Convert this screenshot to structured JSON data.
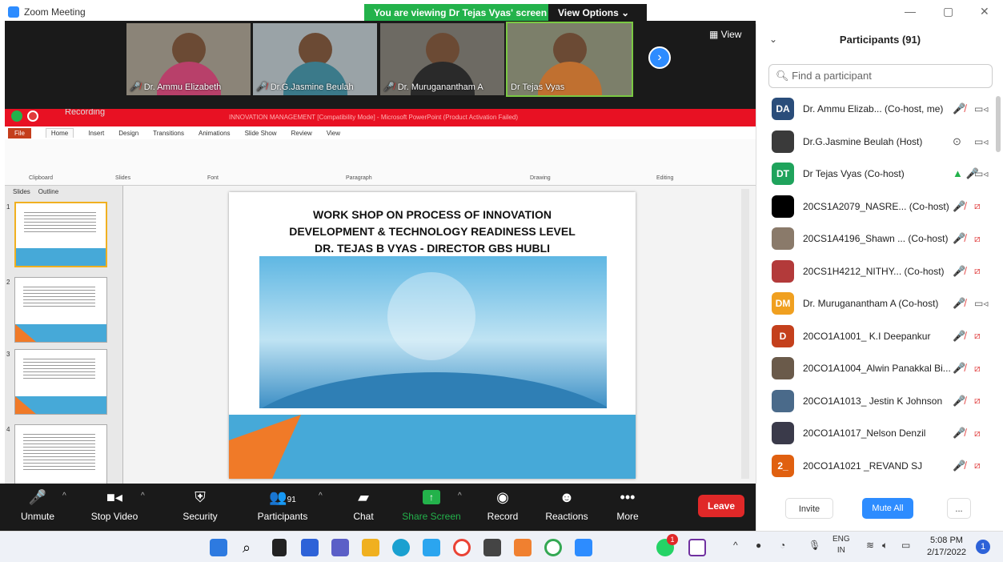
{
  "window": {
    "app_title": "Zoom Meeting",
    "viewing_banner": "You are viewing Dr Tejas Vyas' screen",
    "view_options": "View Options ⌄",
    "minimize": "—",
    "restore": "▢",
    "close": "✕"
  },
  "video_strip": {
    "view_label": "▦ View",
    "tiles": [
      {
        "name": "Dr. Ammu Elizabeth",
        "muted": true
      },
      {
        "name": "Dr.G.Jasmine Beulah",
        "muted": true
      },
      {
        "name": "Dr. Muruganantham A",
        "muted": true
      },
      {
        "name": "Dr Tejas Vyas",
        "muted": false
      }
    ]
  },
  "ppt": {
    "recording_label": "Recording",
    "doc_title": "INNOVATION MANAGEMENT [Compatibility Mode] - Microsoft PowerPoint (Product Activation Failed)",
    "tabs": [
      "File",
      "Home",
      "Insert",
      "Design",
      "Transitions",
      "Animations",
      "Slide Show",
      "Review",
      "View"
    ],
    "groups": [
      "Clipboard",
      "Slides",
      "Font",
      "Paragraph",
      "Drawing",
      "Editing"
    ],
    "panel_tabs": [
      "Slides",
      "Outline"
    ],
    "slide_title_lines": [
      "WORK SHOP ON PROCESS OF INNOVATION",
      "DEVELOPMENT & TECHNOLOGY READINESS LEVEL",
      "DR. TEJAS B VYAS - DIRECTOR GBS HUBLI"
    ],
    "thumb_numbers": [
      "1",
      "2",
      "3",
      "4"
    ]
  },
  "toolbar": {
    "unmute": "Unmute",
    "stop_video": "Stop Video",
    "security": "Security",
    "participants": "Participants",
    "participants_count": "91",
    "chat": "Chat",
    "share_screen": "Share Screen",
    "record": "Record",
    "reactions": "Reactions",
    "more": "More",
    "leave": "Leave"
  },
  "panel": {
    "title": "Participants (91)",
    "search_placeholder": "Find a participant",
    "participants": [
      {
        "initials": "DA",
        "name": "Dr. Ammu Elizab... (Co-host, me)",
        "color": "#2a4d7a",
        "audio": "muted",
        "video": "on"
      },
      {
        "initials": "",
        "name": "Dr.G.Jasmine Beulah (Host)",
        "color": "#3a3a3a",
        "audio": "share",
        "video": "on"
      },
      {
        "initials": "DT",
        "name": "Dr Tejas Vyas (Co-host)",
        "color": "#1fa35c",
        "audio": "live",
        "video": "on"
      },
      {
        "initials": "",
        "name": "20CS1A2079_NASRE... (Co-host)",
        "color": "#000000",
        "audio": "muted",
        "video": "off"
      },
      {
        "initials": "",
        "name": "20CS1A4196_Shawn ... (Co-host)",
        "color": "#8a7a6a",
        "audio": "muted",
        "video": "off"
      },
      {
        "initials": "",
        "name": "20CS1H4212_NITHY... (Co-host)",
        "color": "#b33a3a",
        "audio": "muted",
        "video": "off"
      },
      {
        "initials": "DM",
        "name": "Dr. Muruganantham A (Co-host)",
        "color": "#f0a020",
        "audio": "muted",
        "video": "on"
      },
      {
        "initials": "D",
        "name": "20CO1A1001_ K.I Deepankur",
        "color": "#c4401c",
        "audio": "muted",
        "video": "off"
      },
      {
        "initials": "",
        "name": "20CO1A1004_Alwin Panakkal Bi...",
        "color": "#6a5a4a",
        "audio": "muted",
        "video": "off"
      },
      {
        "initials": "",
        "name": "20CO1A1013_ Jestin K Johnson",
        "color": "#4a6a8a",
        "audio": "muted",
        "video": "off"
      },
      {
        "initials": "",
        "name": "20CO1A1017_Nelson Denzil",
        "color": "#3a3a4a",
        "audio": "muted",
        "video": "off"
      },
      {
        "initials": "2_",
        "name": "20CO1A1021 _REVAND SJ",
        "color": "#e06010",
        "audio": "muted",
        "video": "off"
      }
    ],
    "invite": "Invite",
    "mute_all": "Mute All",
    "more_dots": "..."
  },
  "taskbar": {
    "lang": "ENG",
    "region": "IN",
    "time": "5:08 PM",
    "date": "2/17/2022",
    "notif_count": "1",
    "whatsapp_badge": "1"
  }
}
